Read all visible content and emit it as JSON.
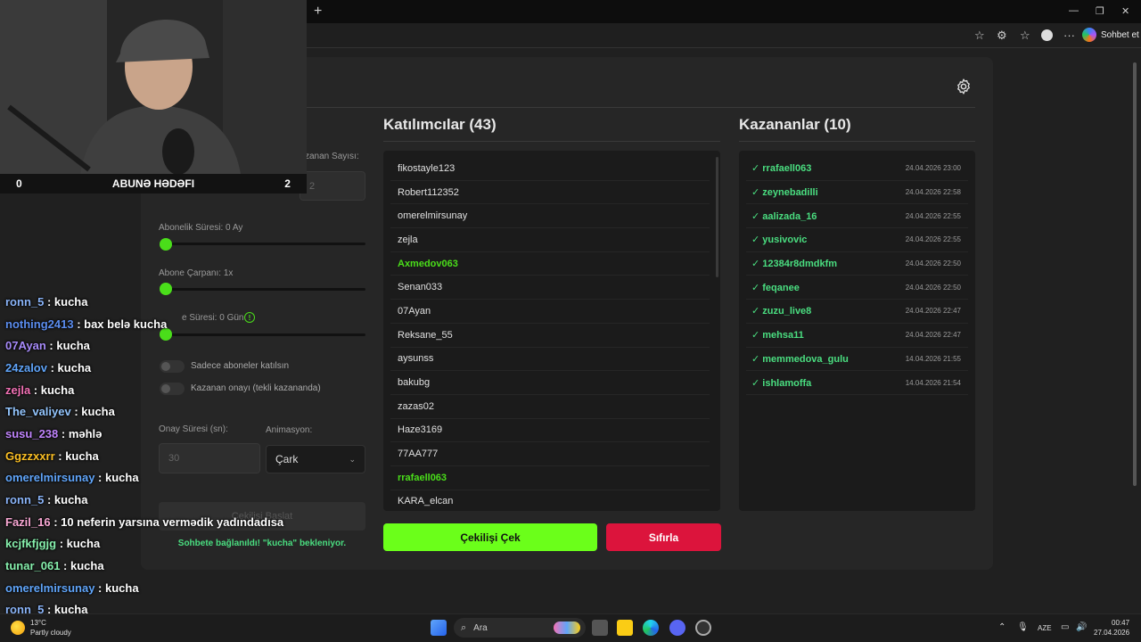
{
  "browser": {
    "new_tab": "+",
    "copilot_label": "Sohbet et",
    "window_controls": [
      "—",
      "❐",
      "✕"
    ]
  },
  "settings": {
    "winner_count_label": "zanan Sayısı:",
    "winner_count_value": "2",
    "sub_duration_label": "Abonelik Süresi: 0 Ay",
    "sub_multiplier_label": "Abone Çarpanı: 1x",
    "follow_duration_label": "e Süresi:  0  Gün",
    "only_subs_label": "Sadece aboneler katılsın",
    "winner_confirm_label": "Kazanan onayı (tekli kazananda)",
    "confirm_time_label": "Onay Süresi (sn):",
    "confirm_time_value": "30",
    "animation_label": "Animasyon:",
    "animation_value": "Çark",
    "start_button": "Çekilişi Başlat",
    "status": "Sohbete bağlanıldı! \"kucha\" bekleniyor."
  },
  "participants": {
    "title": "Katılımcılar (43)",
    "items": [
      {
        "name": "fikostayle123",
        "winner": false
      },
      {
        "name": "Robert112352",
        "winner": false
      },
      {
        "name": "omerelmirsunay",
        "winner": false
      },
      {
        "name": "zejla",
        "winner": false
      },
      {
        "name": "Axmedov063",
        "winner": true
      },
      {
        "name": "Senan033",
        "winner": false
      },
      {
        "name": "07Ayan",
        "winner": false
      },
      {
        "name": "Reksane_55",
        "winner": false
      },
      {
        "name": "aysunss",
        "winner": false
      },
      {
        "name": "bakubg",
        "winner": false
      },
      {
        "name": "zazas02",
        "winner": false
      },
      {
        "name": "Haze3169",
        "winner": false
      },
      {
        "name": "77AA777",
        "winner": false
      },
      {
        "name": "rrafaell063",
        "winner": true
      },
      {
        "name": "KARA_elcan",
        "winner": false
      }
    ]
  },
  "winners": {
    "title": "Kazananlar (10)",
    "items": [
      {
        "name": "✓ rrafaell063",
        "date": "24.04.2026 23:00"
      },
      {
        "name": "✓ zeynebadilli",
        "date": "24.04.2026 22:58"
      },
      {
        "name": "✓ aalizada_16",
        "date": "24.04.2026 22:55"
      },
      {
        "name": "✓ yusivovic",
        "date": "24.04.2026 22:55"
      },
      {
        "name": "✓ 12384r8dmdkfm",
        "date": "24.04.2026 22:50"
      },
      {
        "name": "✓ feqanee",
        "date": "24.04.2026 22:50"
      },
      {
        "name": "✓ zuzu_live8",
        "date": "24.04.2026 22:47"
      },
      {
        "name": "✓ mehsa11",
        "date": "24.04.2026 22:47"
      },
      {
        "name": "✓ memmedova_gulu",
        "date": "14.04.2026 21:55"
      },
      {
        "name": "✓ ishlamoffa",
        "date": "14.04.2026 21:54"
      }
    ]
  },
  "actions": {
    "draw": "Çekilişi Çek",
    "reset": "Sıfırla"
  },
  "stream": {
    "goal_left": "0",
    "goal_label": "ABUNƏ HƏDƏFI",
    "goal_right": "2",
    "chat": [
      {
        "user": "ronn_5",
        "msg": "kucha",
        "color": "#8ab4f8"
      },
      {
        "user": "nothing2413",
        "msg": "bax belə kucha",
        "color": "#5b8def"
      },
      {
        "user": "07Ayan",
        "msg": "kucha",
        "color": "#a78bfa"
      },
      {
        "user": "24zalov",
        "msg": "kucha",
        "color": "#60a5fa"
      },
      {
        "user": "zejla",
        "msg": "kucha",
        "color": "#f472b6"
      },
      {
        "user": "The_valiyev",
        "msg": "kucha",
        "color": "#93c5fd"
      },
      {
        "user": "susu_238",
        "msg": "məhlə",
        "color": "#c084fc"
      },
      {
        "user": "Ggzzxxrr",
        "msg": "kucha",
        "color": "#fbbf24"
      },
      {
        "user": "omerelmirsunay",
        "msg": "kucha",
        "color": "#60a5fa"
      },
      {
        "user": "ronn_5",
        "msg": "kucha",
        "color": "#8ab4f8"
      },
      {
        "user": "Fazil_16",
        "msg": "10 neferin yarsına vermədik yadındadısa",
        "color": "#f9a8d4"
      },
      {
        "user": "kcjfkfjgjg",
        "msg": "kucha",
        "color": "#86efac"
      },
      {
        "user": "tunar_061",
        "msg": "kucha",
        "color": "#86efac"
      },
      {
        "user": "omerelmirsunay",
        "msg": "kucha",
        "color": "#60a5fa"
      },
      {
        "user": "ronn_5",
        "msg": "kucha",
        "color": "#8ab4f8"
      }
    ]
  },
  "taskbar": {
    "temperature": "13°C",
    "weather": "Partly cloudy",
    "search_placeholder": "Ara",
    "language": "AZE",
    "time": "00:47",
    "date": "27.04.2026"
  },
  "colors": {
    "accent_green": "#6bff1a",
    "reset_red": "#dc143c",
    "winner_green": "#4ade80"
  }
}
